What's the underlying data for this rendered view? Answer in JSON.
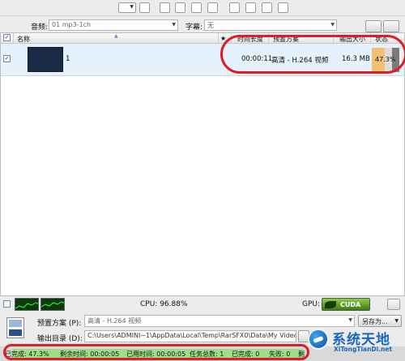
{
  "selectors": {
    "audio_label": "音频:",
    "audio_value": "01 mp3-1ch",
    "subtitle_label": "字幕:",
    "subtitle_value": "无"
  },
  "list": {
    "headers": [
      "名称",
      "时间长度",
      "预置方案",
      "输出大小",
      "状态"
    ],
    "star_symbol": "★",
    "rows": [
      {
        "name": "1",
        "duration": "00:00:11",
        "preset": "高清 - H.264 视频",
        "size": "16.3 MB",
        "progress_text": "47.3%",
        "progress_value": 47.3,
        "checked": true
      }
    ]
  },
  "monitor": {
    "cpu_text": "CPU: 96.88%",
    "gpu_label": "GPU:",
    "cuda_label": "CUDA"
  },
  "bottom": {
    "preset_label": "预置方案 (P):",
    "preset_value": "高清 - H.264 视频",
    "save_as_label": "另存为...",
    "output_label": "输出目录 (D):",
    "output_value": "C:\\Users\\ADMINI~1\\AppData\\Local\\Temp\\RarSFX0\\Data\\My Video"
  },
  "status": {
    "completed": "已完成: 47.3%",
    "remaining": "剩余时间: 00:00:05",
    "elapsed": "已用时间: 00:00:05",
    "tasks": "任务总数: 1",
    "done": "已完成: 0",
    "errors": "失败: 0",
    "last": "剩"
  },
  "watermark": {
    "title": "系统天地",
    "url": "XiTongTianDi.net"
  },
  "colors": {
    "selected_row": "#e5f1fb",
    "progress_fill": "#f0c170",
    "status_fill": "#9ede87",
    "annotation": "#e01d23"
  }
}
